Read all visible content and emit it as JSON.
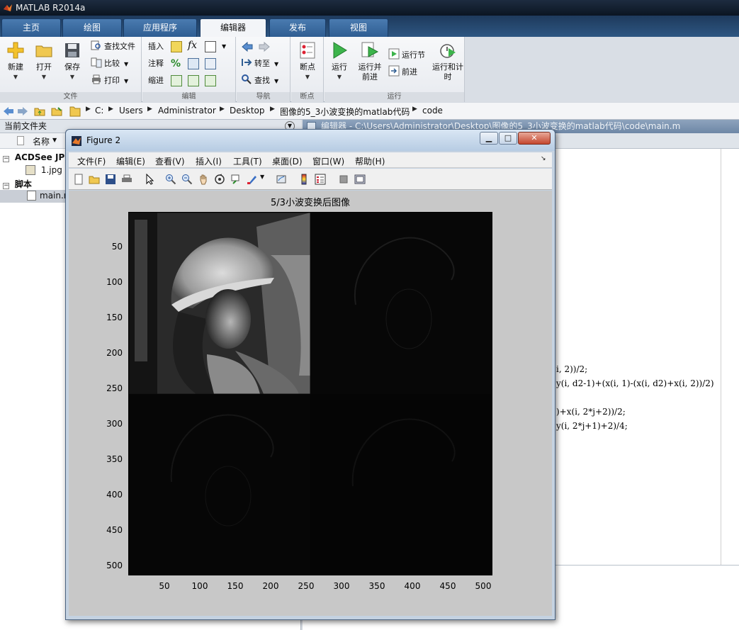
{
  "app": {
    "title": "MATLAB R2014a"
  },
  "tabs": [
    "主页",
    "绘图",
    "应用程序",
    "编辑器",
    "发布",
    "视图"
  ],
  "active_tab": 3,
  "ribbon": {
    "file": {
      "title": "文件",
      "new": "新建",
      "open": "打开",
      "save": "保存",
      "find_files": "查找文件",
      "compare": "比较",
      "print": "打印"
    },
    "edit": {
      "title": "编辑",
      "insert": "插入",
      "comment": "注释",
      "indent": "缩进",
      "fx": "fx"
    },
    "navigate": {
      "title": "导航",
      "goto": "转至",
      "find": "查找"
    },
    "breakpoints": {
      "title": "断点",
      "breakpoints": "断点"
    },
    "run": {
      "title": "运行",
      "run": "运行",
      "run_advance": "运行并前进",
      "run_section": "运行节",
      "advance": "前进",
      "run_time": "运行和计时"
    }
  },
  "address": {
    "crumbs": [
      "C:",
      "Users",
      "Administrator",
      "Desktop",
      "图像的5_3小波变换的matlab代码",
      "code"
    ]
  },
  "folder_panel": {
    "title": "当前文件夹",
    "col_name": "名称",
    "groups": [
      {
        "label": "ACDSee JPE",
        "items": [
          "1.jpg"
        ]
      },
      {
        "label": "脚本",
        "items": [
          "main.m"
        ]
      }
    ]
  },
  "editor": {
    "title": "编辑器 - C:\\Users\\Administrator\\Desktop\\图像的5_3小波变换的matlab代码\\code\\main.m",
    "code_fragments": [
      "i, 2))/2;",
      "y(i, d2-1)+(x(i, 1)-(x(i, d2)+x(i, 2))/2)",
      ")+x(i, 2*j+2))/2;",
      "y(i, 2*j+1)+2)/4;"
    ]
  },
  "figure": {
    "title": "Figure 2",
    "menu": [
      "文件(F)",
      "编辑(E)",
      "查看(V)",
      "插入(I)",
      "工具(T)",
      "桌面(D)",
      "窗口(W)",
      "帮助(H)"
    ],
    "plot_title": "5/3小波变换后图像",
    "yticks": [
      "50",
      "100",
      "150",
      "200",
      "250",
      "300",
      "350",
      "400",
      "450",
      "500"
    ],
    "xticks": [
      "50",
      "100",
      "150",
      "200",
      "250",
      "300",
      "350",
      "400",
      "450",
      "500"
    ]
  },
  "colors": {
    "ribbon_tab": "#2e5d92",
    "figure_bg": "#c8c8c8",
    "axes_bg": "#040404"
  }
}
